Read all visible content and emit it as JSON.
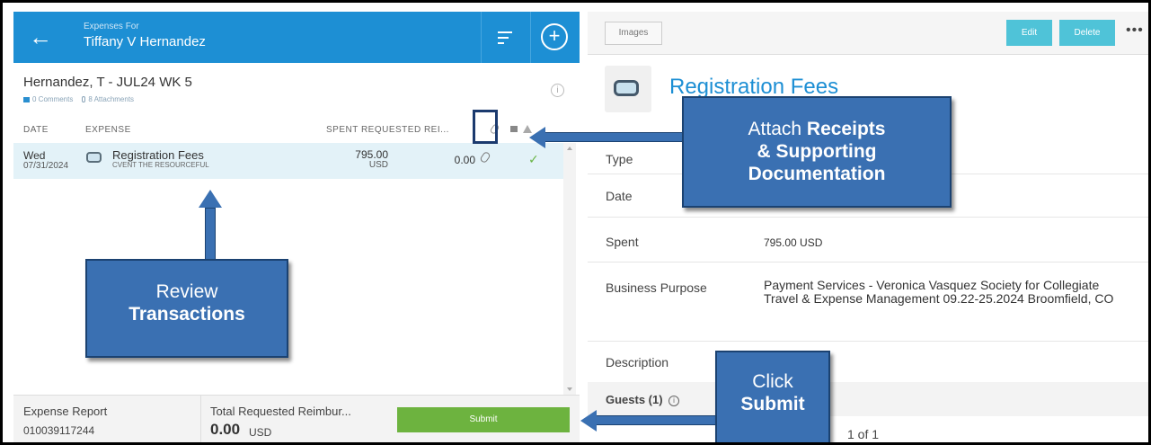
{
  "header": {
    "label": "Expenses For",
    "name": "Tiffany V Hernandez",
    "back_icon": "←",
    "add_icon": "+"
  },
  "report": {
    "title": "Hernandez, T - JUL24 WK 5",
    "comments": "0 Comments",
    "attachments": "8 Attachments",
    "info_icon": "i"
  },
  "columns": {
    "date": "DATE",
    "expense": "EXPENSE",
    "spent_requested": "SPENT REQUESTED REI..."
  },
  "rows": [
    {
      "day": "Wed",
      "date": "07/31/2024",
      "name": "Registration Fees",
      "vendor": "CVENT THE RESOURCEFUL",
      "spent": "795.00",
      "currency": "USD",
      "requested": "0.00",
      "check": "✓"
    }
  ],
  "footer": {
    "report_label": "Expense Report",
    "report_id": "010039117244",
    "total_label": "Total Requested Reimbur...",
    "total_amount": "0.00",
    "total_currency": "USD",
    "submit_label": "Submit"
  },
  "detail": {
    "images_label": "Images",
    "edit_label": "Edit",
    "delete_label": "Delete",
    "more_label": "•••",
    "title": "Registration Fees",
    "type_label": "Type",
    "date_label": "Date",
    "spent_label": "Spent",
    "spent_value": "795.00 USD",
    "purpose_label": "Business Purpose",
    "purpose_value": "Payment Services - Veronica Vasquez Society for Collegiate Travel & Expense Management 09.22-25.2024 Broomfield, CO",
    "description_label": "Description",
    "guests_label": "Guests (1)",
    "guests_info": "i",
    "pager": "1 of 1"
  },
  "callouts": {
    "review_line1": "Review",
    "review_line2": "Transactions",
    "attach_line1_a": "Attach ",
    "attach_line1_b": "Receipts",
    "attach_line2": "& Supporting",
    "attach_line3": "Documentation",
    "submit_line1": "Click",
    "submit_line2": "Submit"
  },
  "colors": {
    "header_blue": "#1d8fd4",
    "submit_green": "#6db33f",
    "action_teal": "#4fc3d8",
    "callout_blue": "#3a70b2"
  }
}
